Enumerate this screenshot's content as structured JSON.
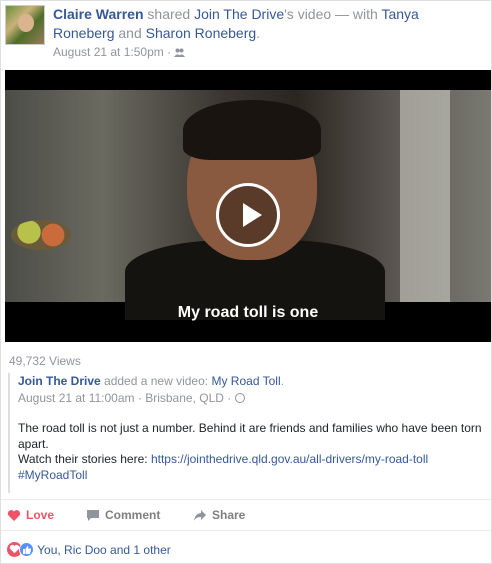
{
  "post": {
    "author": "Claire Warren",
    "shared_text": "shared",
    "page_name": "Join The Drive",
    "possessive": "'s video — with",
    "tagged_1": "Tanya Roneberg",
    "and_text": "and",
    "tagged_2": "Sharon Roneberg",
    "period": ".",
    "timestamp": "August 21 at 1:50pm",
    "separator": "·",
    "audience_icon": "friends-icon"
  },
  "video": {
    "caption": "My road toll is one",
    "play_icon": "play-icon",
    "views": "49,732 Views"
  },
  "shared_post": {
    "page_name": "Join The Drive",
    "added_text": "added a new video:",
    "video_title": "My Road Toll",
    "period": ".",
    "timestamp": "August 21 at 11:00am",
    "separator": "·",
    "location": "Brisbane, QLD",
    "separator2": "·",
    "audience_icon": "globe-icon",
    "description_1": "The road toll is not just a number. Behind it are friends and families who have been torn apart.",
    "description_2": "Watch their stories here:",
    "url": "https://jointhedrive.qld.gov.au/all-drivers/my-road-toll",
    "hashtag": "#MyRoadToll"
  },
  "actions": {
    "love": "Love",
    "comment": "Comment",
    "share": "Share"
  },
  "reactions": {
    "summary": "You, Ric Doo and 1 other"
  },
  "colors": {
    "link": "#365899",
    "love": "#f25268",
    "like": "#5890ff",
    "muted": "#90949c"
  }
}
